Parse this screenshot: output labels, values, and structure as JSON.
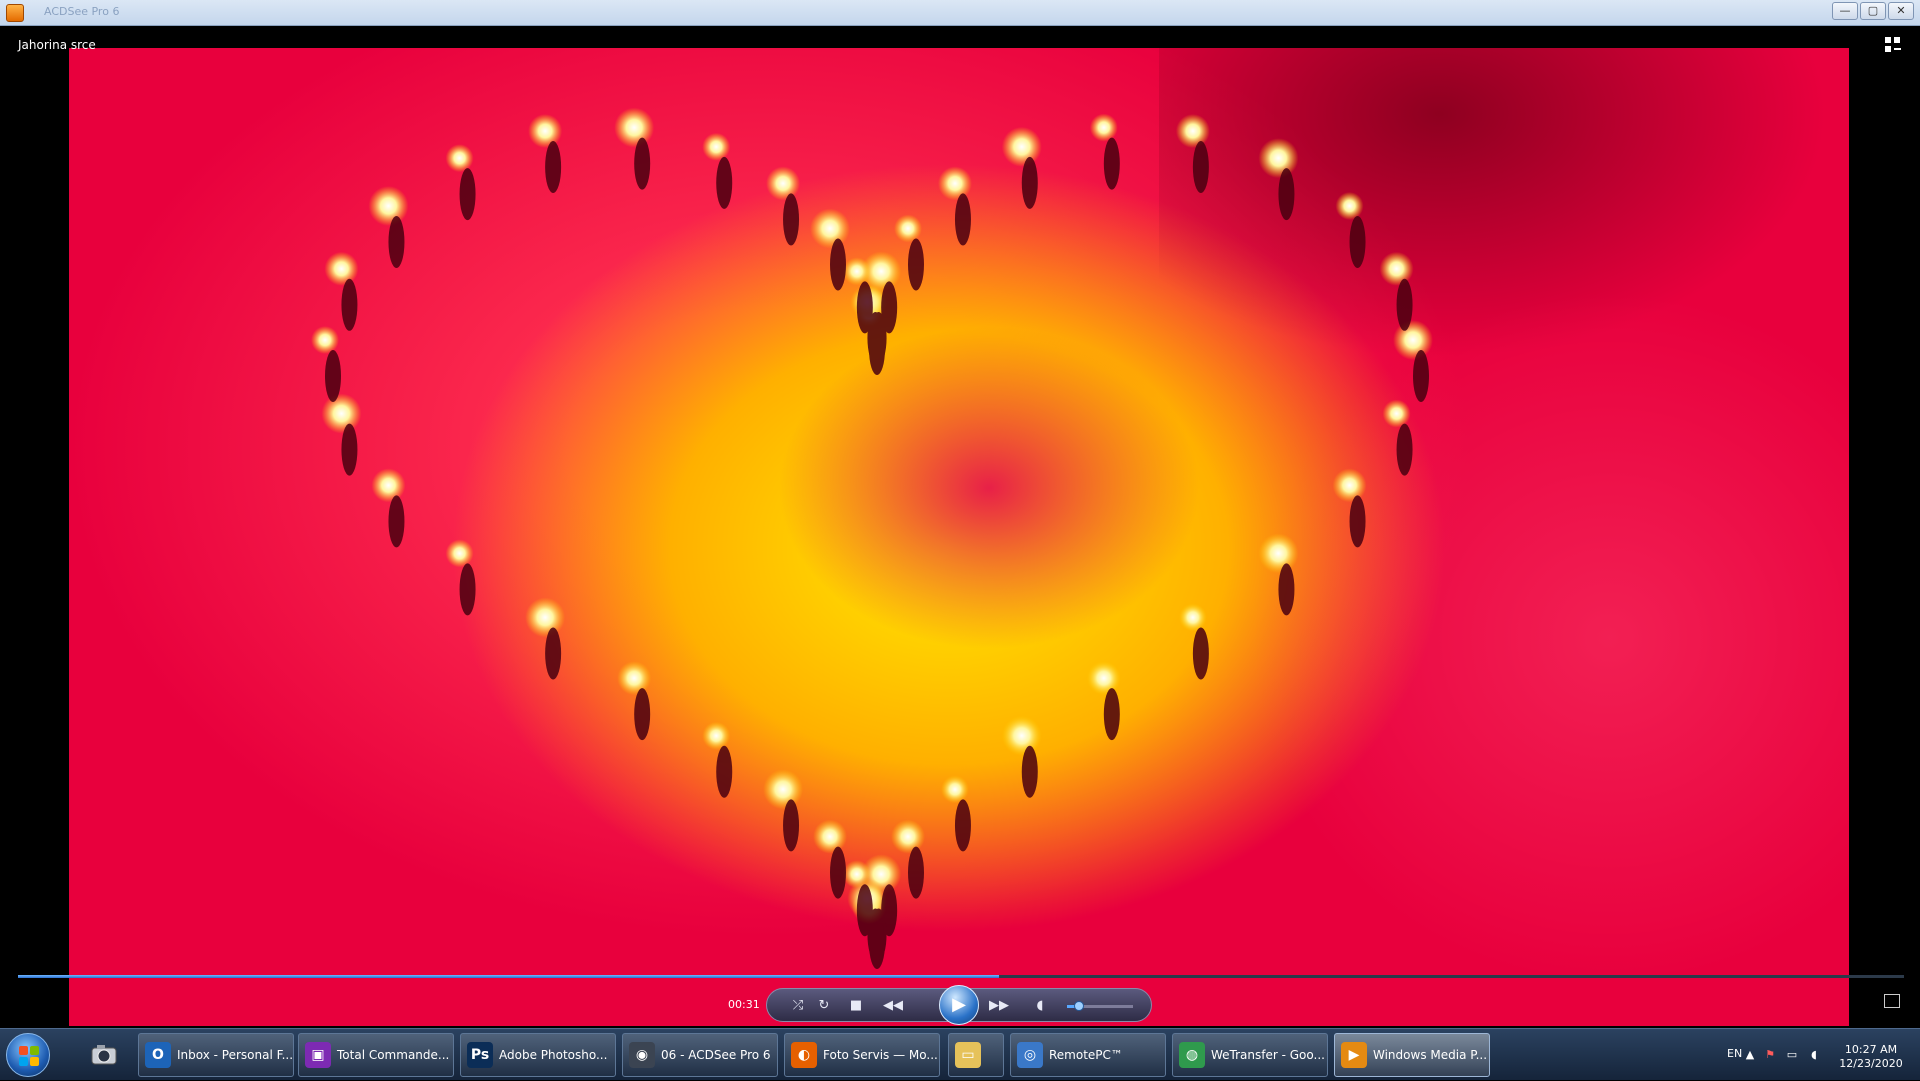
{
  "window": {
    "title": "ACDSee Pro 6",
    "buttons": {
      "minimize": "—",
      "maximize": "▢",
      "close": "✕"
    }
  },
  "player": {
    "clip_title": "Jahorina srce",
    "time": "00:31",
    "progress": 0.52,
    "volume": 0.18,
    "controls": {
      "shuffle_icon": "shuffle-icon",
      "repeat_icon": "repeat-icon",
      "stop_icon": "stop-icon",
      "previous_icon": "previous-icon",
      "play_icon": "play-icon",
      "next_icon": "next-icon",
      "mute_icon": "speaker-icon"
    },
    "colors": {
      "accent": "#2a72c8",
      "control_bar": "#3f3d5e"
    }
  },
  "taskbar": {
    "items": [
      {
        "label": "Inbox - Personal F...",
        "icon": "outlook-icon",
        "color": "#1d64b8",
        "glyph": "O"
      },
      {
        "label": "Total Commande...",
        "icon": "total-commander-icon",
        "color": "#7d2ab3",
        "glyph": "▣"
      },
      {
        "label": "Adobe Photosho...",
        "icon": "photoshop-icon",
        "color": "#0b2d57",
        "glyph": "Ps"
      },
      {
        "label": "06 - ACDSee Pro 6",
        "icon": "acdsee-icon",
        "color": "#3b4452",
        "glyph": "◉"
      },
      {
        "label": "Foto Servis — Mo...",
        "icon": "firefox-icon",
        "color": "#e66000",
        "glyph": "◐"
      },
      {
        "label": "",
        "icon": "explorer-folder-icon",
        "color": "#e6c25a",
        "glyph": "▭"
      },
      {
        "label": "RemotePC™",
        "icon": "remotepc-icon",
        "color": "#3a78c8",
        "glyph": "◎"
      },
      {
        "label": "WeTransfer - Goo...",
        "icon": "chrome-icon",
        "color": "#2f9a4d",
        "glyph": "◍"
      },
      {
        "label": "Windows Media P...",
        "icon": "media-player-icon",
        "color": "#e58a12",
        "glyph": "▶"
      }
    ],
    "language": "EN",
    "clock_time": "10:27 AM",
    "clock_date": "12/23/2020"
  }
}
